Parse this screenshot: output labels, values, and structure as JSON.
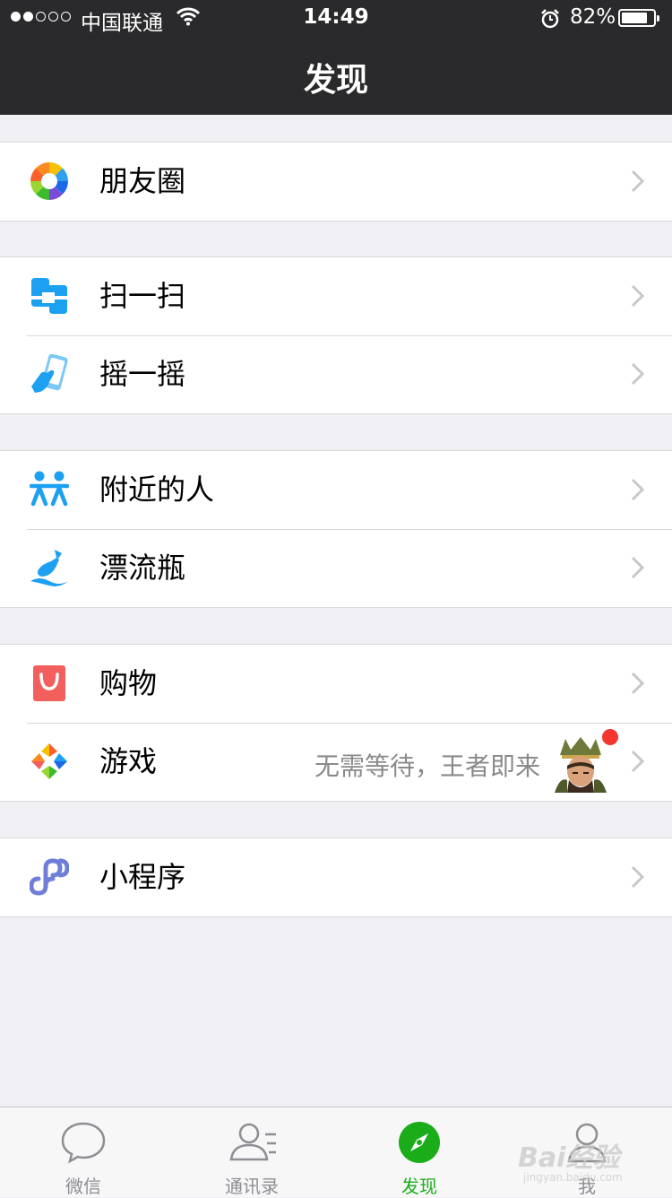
{
  "status_bar": {
    "carrier": "中国联通",
    "time": "14:49",
    "battery": "82%",
    "battery_level": 0.82,
    "signal_bars": 2
  },
  "nav": {
    "title": "发现"
  },
  "groups": [
    {
      "items": [
        {
          "label": "朋友圈",
          "icon": "moments-icon"
        }
      ]
    },
    {
      "items": [
        {
          "label": "扫一扫",
          "icon": "scan-icon"
        },
        {
          "label": "摇一摇",
          "icon": "shake-icon"
        }
      ]
    },
    {
      "items": [
        {
          "label": "附近的人",
          "icon": "people-nearby-icon"
        },
        {
          "label": "漂流瓶",
          "icon": "drift-bottle-icon"
        }
      ]
    },
    {
      "items": [
        {
          "label": "购物",
          "icon": "shopping-icon"
        },
        {
          "label": "游戏",
          "icon": "games-icon",
          "subtitle": "无需等待，王者即来",
          "badge": "red-dot"
        }
      ]
    },
    {
      "items": [
        {
          "label": "小程序",
          "icon": "mini-program-icon"
        }
      ]
    }
  ],
  "tabbar": {
    "tabs": [
      {
        "label": "微信",
        "icon": "chat-bubble-icon",
        "active": false
      },
      {
        "label": "通讯录",
        "icon": "contacts-icon",
        "active": false
      },
      {
        "label": "发现",
        "icon": "compass-icon",
        "active": true
      },
      {
        "label": "我",
        "icon": "me-icon",
        "active": false
      }
    ]
  },
  "watermark": {
    "main": "Bai",
    "suffix": "经验",
    "url": "jingyan.baidu.com"
  },
  "colors": {
    "navbar": "#2a2a2c",
    "background": "#efeff4",
    "accent_green": "#1aad19",
    "badge_red": "#f43530"
  }
}
